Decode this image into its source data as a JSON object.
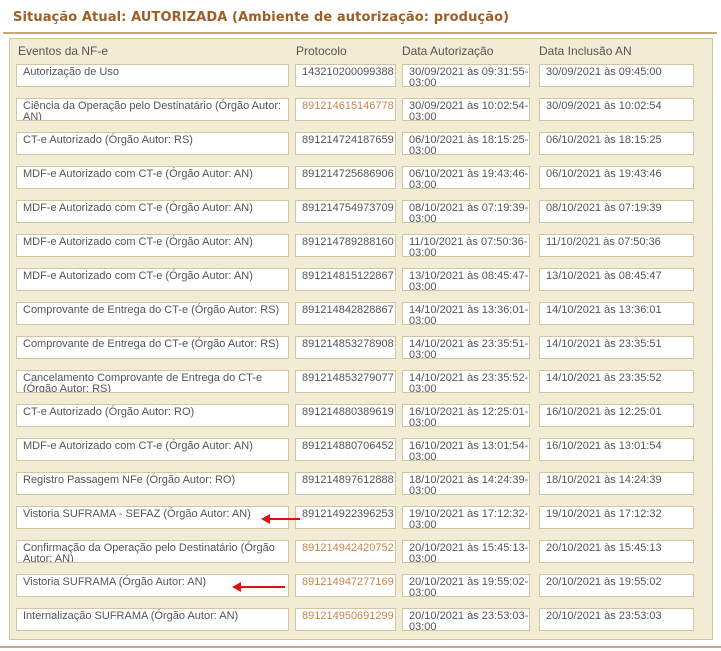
{
  "title": "Situação Atual: AUTORIZADA (Ambiente de autorização: produção)",
  "headers": {
    "eventos": "Eventos da NF-e",
    "protocolo": "Protocolo",
    "data_autorizacao": "Data Autorização",
    "data_inclusao": "Data Inclusão AN"
  },
  "rows": [
    {
      "evento": "Autorização de Uso",
      "protocolo": "143210200099388",
      "data_autorizacao": "30/09/2021 às 09:31:55-03:00",
      "data_inclusao": "30/09/2021 às 09:45:00",
      "link": false,
      "arrow": false
    },
    {
      "evento": "Ciência da Operação pelo Destinatário (Órgão Autor: AN)",
      "protocolo": "891214615146778",
      "data_autorizacao": "30/09/2021 às 10:02:54-03:00",
      "data_inclusao": "30/09/2021 às 10:02:54",
      "link": true,
      "arrow": false
    },
    {
      "evento": "CT-e Autorizado (Órgão Autor: RS)",
      "protocolo": "891214724187659",
      "data_autorizacao": "06/10/2021 às 18:15:25-03:00",
      "data_inclusao": "06/10/2021 às 18:15:25",
      "link": false,
      "arrow": false
    },
    {
      "evento": "MDF-e Autorizado com CT-e (Órgão Autor: AN)",
      "protocolo": "891214725686906",
      "data_autorizacao": "06/10/2021 às 19:43:46-03:00",
      "data_inclusao": "06/10/2021 às 19:43:46",
      "link": false,
      "arrow": false
    },
    {
      "evento": "MDF-e Autorizado com CT-e (Órgão Autor: AN)",
      "protocolo": "891214754973709",
      "data_autorizacao": "08/10/2021 às 07:19:39-03:00",
      "data_inclusao": "08/10/2021 às 07:19:39",
      "link": false,
      "arrow": false
    },
    {
      "evento": "MDF-e Autorizado com CT-e (Órgão Autor: AN)",
      "protocolo": "891214789288160",
      "data_autorizacao": "11/10/2021 às 07:50:36-03:00",
      "data_inclusao": "11/10/2021 às 07:50:36",
      "link": false,
      "arrow": false
    },
    {
      "evento": "MDF-e Autorizado com CT-e (Órgão Autor: AN)",
      "protocolo": "891214815122867",
      "data_autorizacao": "13/10/2021 às 08:45:47-03:00",
      "data_inclusao": "13/10/2021 às 08:45:47",
      "link": false,
      "arrow": false
    },
    {
      "evento": "Comprovante de Entrega do CT-e (Órgão Autor: RS)",
      "protocolo": "891214842828867",
      "data_autorizacao": "14/10/2021 às 13:36:01-03:00",
      "data_inclusao": "14/10/2021 às 13:36:01",
      "link": false,
      "arrow": false
    },
    {
      "evento": "Comprovante de Entrega do CT-e (Órgão Autor: RS)",
      "protocolo": "891214853278908",
      "data_autorizacao": "14/10/2021 às 23:35:51-03:00",
      "data_inclusao": "14/10/2021 às 23:35:51",
      "link": false,
      "arrow": false
    },
    {
      "evento": "Cancelamento Comprovante de Entrega do CT-e (Órgão Autor: RS)",
      "protocolo": "891214853279077",
      "data_autorizacao": "14/10/2021 às 23:35:52-03:00",
      "data_inclusao": "14/10/2021 às 23:35:52",
      "link": false,
      "arrow": false
    },
    {
      "evento": "CT-e Autorizado (Órgão Autor: RO)",
      "protocolo": "891214880389619",
      "data_autorizacao": "16/10/2021 às 12:25:01-03:00",
      "data_inclusao": "16/10/2021 às 12:25:01",
      "link": false,
      "arrow": false
    },
    {
      "evento": "MDF-e Autorizado com CT-e (Órgão Autor: AN)",
      "protocolo": "891214880706452",
      "data_autorizacao": "16/10/2021 às 13:01:54-03:00",
      "data_inclusao": "16/10/2021 às 13:01:54",
      "link": false,
      "arrow": false
    },
    {
      "evento": "Registro Passagem NFe (Órgão Autor: RO)",
      "protocolo": "891214897612888",
      "data_autorizacao": "18/10/2021 às 14:24:39-03:00",
      "data_inclusao": "18/10/2021 às 14:24:39",
      "link": false,
      "arrow": false
    },
    {
      "evento": "Vistoria SUFRAMA - SEFAZ (Órgão Autor: AN)",
      "protocolo": "891214922396253",
      "data_autorizacao": "19/10/2021 às 17:12:32-03:00",
      "data_inclusao": "19/10/2021 às 17:12:32",
      "link": false,
      "arrow": true
    },
    {
      "evento": "Confirmação da Operação pelo Destinatário (Órgão Autor: AN)",
      "protocolo": "891214942420752",
      "data_autorizacao": "20/10/2021 às 15:45:13-03:00",
      "data_inclusao": "20/10/2021 às 15:45:13",
      "link": true,
      "arrow": false
    },
    {
      "evento": "Vistoria SUFRAMA (Órgão Autor: AN)",
      "protocolo": "891214947277169",
      "data_autorizacao": "20/10/2021 às 19:55:02-03:00",
      "data_inclusao": "20/10/2021 às 19:55:02",
      "link": true,
      "arrow": true
    },
    {
      "evento": "Internalização SUFRAMA (Órgão Autor: AN)",
      "protocolo": "891214950691299",
      "data_autorizacao": "20/10/2021 às 23:53:03-03:00",
      "data_inclusao": "20/10/2021 às 23:53:03",
      "link": true,
      "arrow": false
    }
  ],
  "colors": {
    "title": "#a05d24",
    "link": "#c8864a",
    "arrow": "#e01010",
    "panel": "#f3ecd5"
  }
}
